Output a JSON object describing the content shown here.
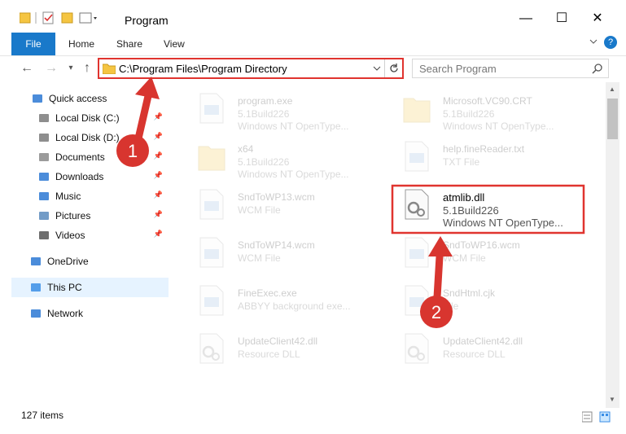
{
  "window": {
    "title": "Program",
    "minimize": "—",
    "maximize": "☐",
    "close": "✕"
  },
  "ribbon": {
    "tabs": [
      "File",
      "Home",
      "Share",
      "View"
    ],
    "help": "?"
  },
  "address": {
    "path": "C:\\Program Files\\Program Directory",
    "search_placeholder": "Search Program"
  },
  "sidebar": {
    "items": [
      {
        "label": "Quick access",
        "icon": "star-icon",
        "pinned": false
      },
      {
        "label": "Local Disk (C:)",
        "icon": "drive-icon",
        "pinned": true
      },
      {
        "label": "Local Disk (D:)",
        "icon": "drive-icon",
        "pinned": true
      },
      {
        "label": "Documents",
        "icon": "documents-icon",
        "pinned": true
      },
      {
        "label": "Downloads",
        "icon": "download-icon",
        "pinned": true
      },
      {
        "label": "Music",
        "icon": "music-icon",
        "pinned": true
      },
      {
        "label": "Pictures",
        "icon": "pictures-icon",
        "pinned": true
      },
      {
        "label": "Videos",
        "icon": "videos-icon",
        "pinned": true
      },
      {
        "label": "OneDrive",
        "icon": "cloud-icon",
        "pinned": false
      },
      {
        "label": "This PC",
        "icon": "computer-icon",
        "pinned": false,
        "selected": true
      },
      {
        "label": "Network",
        "icon": "network-icon",
        "pinned": false
      }
    ]
  },
  "files": [
    {
      "name": "program.exe",
      "type": "5.1Build226",
      "desc": "Windows NT OpenType..."
    },
    {
      "name": "Microsoft.VC90.CRT",
      "type": "5.1Build226",
      "desc": "Windows NT OpenType..."
    },
    {
      "name": "x64",
      "type": "5.1Build226",
      "desc": "Windows NT OpenType..."
    },
    {
      "name": "help.fineReader.txt",
      "type": "TXT File",
      "desc": ""
    },
    {
      "name": "SndToWP13.wcm",
      "type": "WCM File",
      "desc": ""
    },
    {
      "name": "atmlib.dll",
      "type": "5.1Build226",
      "desc": "Windows NT OpenType...",
      "highlighted": true
    },
    {
      "name": "SndToWP14.wcm",
      "type": "WCM File",
      "desc": ""
    },
    {
      "name": "SndToWP16.wcm",
      "type": "WCM File",
      "desc": ""
    },
    {
      "name": "FineExec.exe",
      "type": "ABBYY background exe...",
      "desc": ""
    },
    {
      "name": "SndHtml.cjk",
      "type": "File",
      "desc": ""
    },
    {
      "name": "UpdateClient42.dll",
      "type": "Resource DLL",
      "desc": ""
    },
    {
      "name": "UpdateClient42.dll",
      "type": "Resource DLL",
      "desc": ""
    }
  ],
  "annotations": [
    "1",
    "2"
  ],
  "status": {
    "count": "127 items"
  },
  "colors": {
    "accent": "#1979ca",
    "highlight": "#e0342f"
  }
}
